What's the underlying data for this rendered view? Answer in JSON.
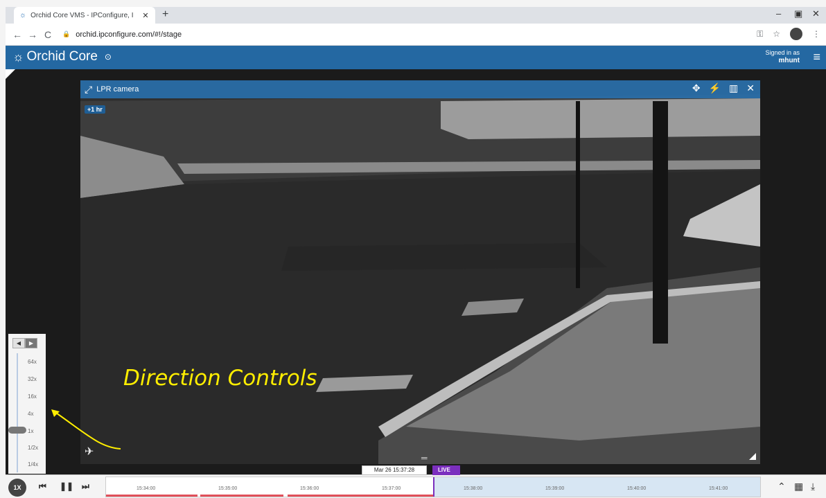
{
  "browser": {
    "tab_title": "Orchid Core VMS - IPConfigure, I",
    "url": "orchid.ipconfigure.com/#!/stage"
  },
  "app": {
    "name": "Orchid Core",
    "signed_in_label": "Signed in as",
    "username": "mhunt"
  },
  "camera": {
    "name": "LPR camera",
    "offset_badge": "+1 hr"
  },
  "speed_controls": {
    "speeds": [
      "64x",
      "32x",
      "16x",
      "4x",
      "1x",
      "1/2x",
      "1/4x"
    ],
    "selected": "1x"
  },
  "annotation": {
    "text": "Direction Controls",
    "color": "#ffee00"
  },
  "playback": {
    "rate_label": "1X",
    "current_time": "Mar 26 15:37:28",
    "live_label": "LIVE",
    "times": [
      "15:34:00",
      "15:35:00",
      "15:36:00",
      "15:37:00",
      "15:38:00",
      "15:39:00",
      "15:40:00",
      "15:41:00"
    ]
  },
  "colors": {
    "header": "#2468a2",
    "recording": "#e0505a",
    "live": "#7b2fbe",
    "future": "#d7e6f3"
  }
}
